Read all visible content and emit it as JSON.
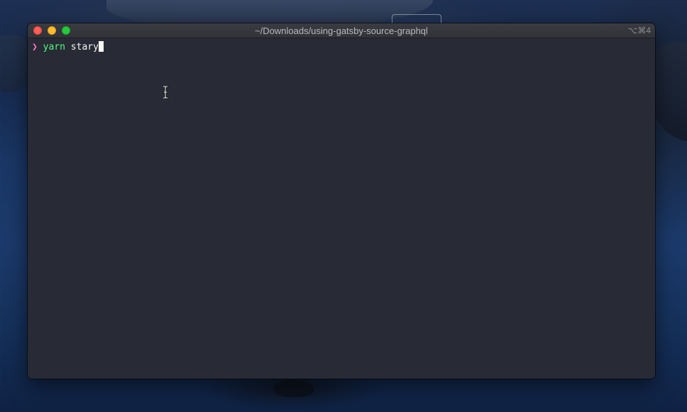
{
  "window": {
    "title": "~/Downloads/using-gatsby-source-graphql",
    "shortcut": "⌥⌘4"
  },
  "terminal": {
    "prompt_symbol": "❯",
    "command": "yarn",
    "argument": "stary"
  },
  "colors": {
    "background": "#282a36",
    "prompt": "#ff79c6",
    "command": "#50fa7b",
    "text": "#f8f8f2"
  },
  "icons": {
    "close": "close-icon",
    "minimize": "minimize-icon",
    "zoom": "zoom-icon",
    "pointer": "text-cursor-icon"
  }
}
